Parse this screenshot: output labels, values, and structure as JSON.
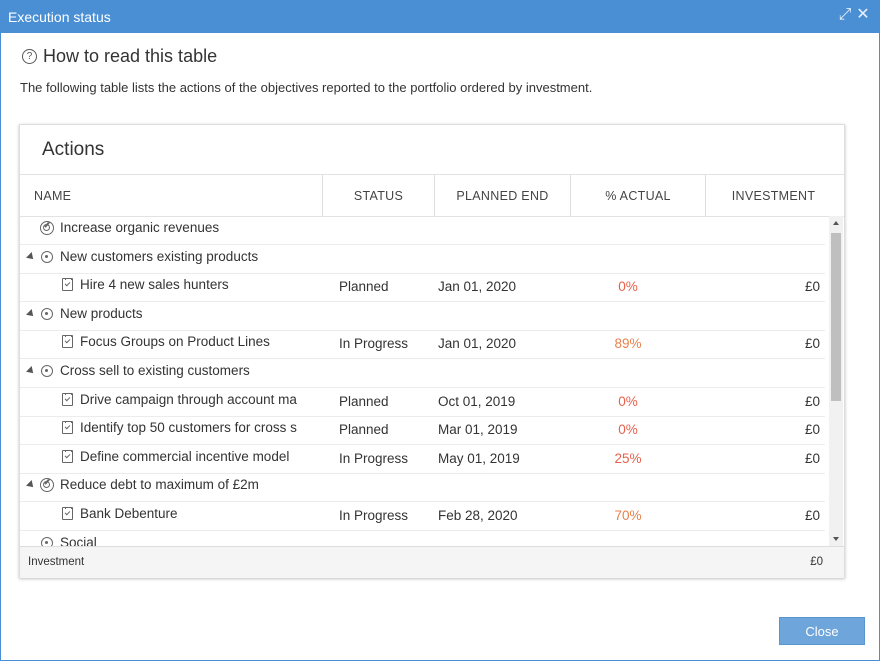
{
  "window": {
    "title": "Execution status",
    "icons": [
      "expand-icon",
      "close-icon"
    ],
    "accent": "#4a8fd4"
  },
  "help": {
    "heading": "How to read this table",
    "icon": "?",
    "description": "The following table lists the actions of the objectives reported to the portfolio ordered by investment."
  },
  "panel": {
    "title": "Actions",
    "columns": [
      "NAME",
      "STATUS",
      "PLANNED END",
      "% ACTUAL",
      "INVESTMENT"
    ],
    "rows": [
      {
        "type": "objective-target",
        "expanded": false,
        "name": "Increase organic revenues"
      },
      {
        "type": "objective",
        "expanded": true,
        "name": "New customers existing products"
      },
      {
        "type": "action",
        "name": "Hire 4 new sales hunters",
        "status": "Planned",
        "end": "Jan 01, 2020",
        "pct": "0%",
        "inv": "£0"
      },
      {
        "type": "objective",
        "expanded": true,
        "name": "New products"
      },
      {
        "type": "action",
        "name": "Focus Groups on Product Lines",
        "status": "In Progress",
        "end": "Jan 01, 2020",
        "pct": "89%",
        "inv": "£0"
      },
      {
        "type": "objective",
        "expanded": true,
        "name": "Cross sell to existing customers"
      },
      {
        "type": "action",
        "name": "Drive campaign through account ma",
        "status": "Planned",
        "end": "Oct 01, 2019",
        "pct": "0%",
        "inv": "£0"
      },
      {
        "type": "action",
        "name": "Identify top 50 customers for cross s",
        "status": "Planned",
        "end": "Mar 01, 2019",
        "pct": "0%",
        "inv": "£0"
      },
      {
        "type": "action",
        "name": "Define commercial incentive model",
        "status": "In Progress",
        "end": "May 01, 2019",
        "pct": "25%",
        "inv": "£0"
      },
      {
        "type": "objective-target",
        "expanded": true,
        "name": "Reduce debt to maximum of £2m"
      },
      {
        "type": "action",
        "name": "Bank Debenture",
        "status": "In Progress",
        "end": "Feb 28, 2020",
        "pct": "70%",
        "inv": "£0"
      },
      {
        "type": "objective",
        "expanded": false,
        "name": "Social"
      }
    ],
    "footer": {
      "label": "Investment",
      "value": "£0"
    },
    "pct_colors": {
      "red": "#e8604c",
      "orange": "#e8804c"
    }
  },
  "buttons": {
    "close": "Close"
  }
}
